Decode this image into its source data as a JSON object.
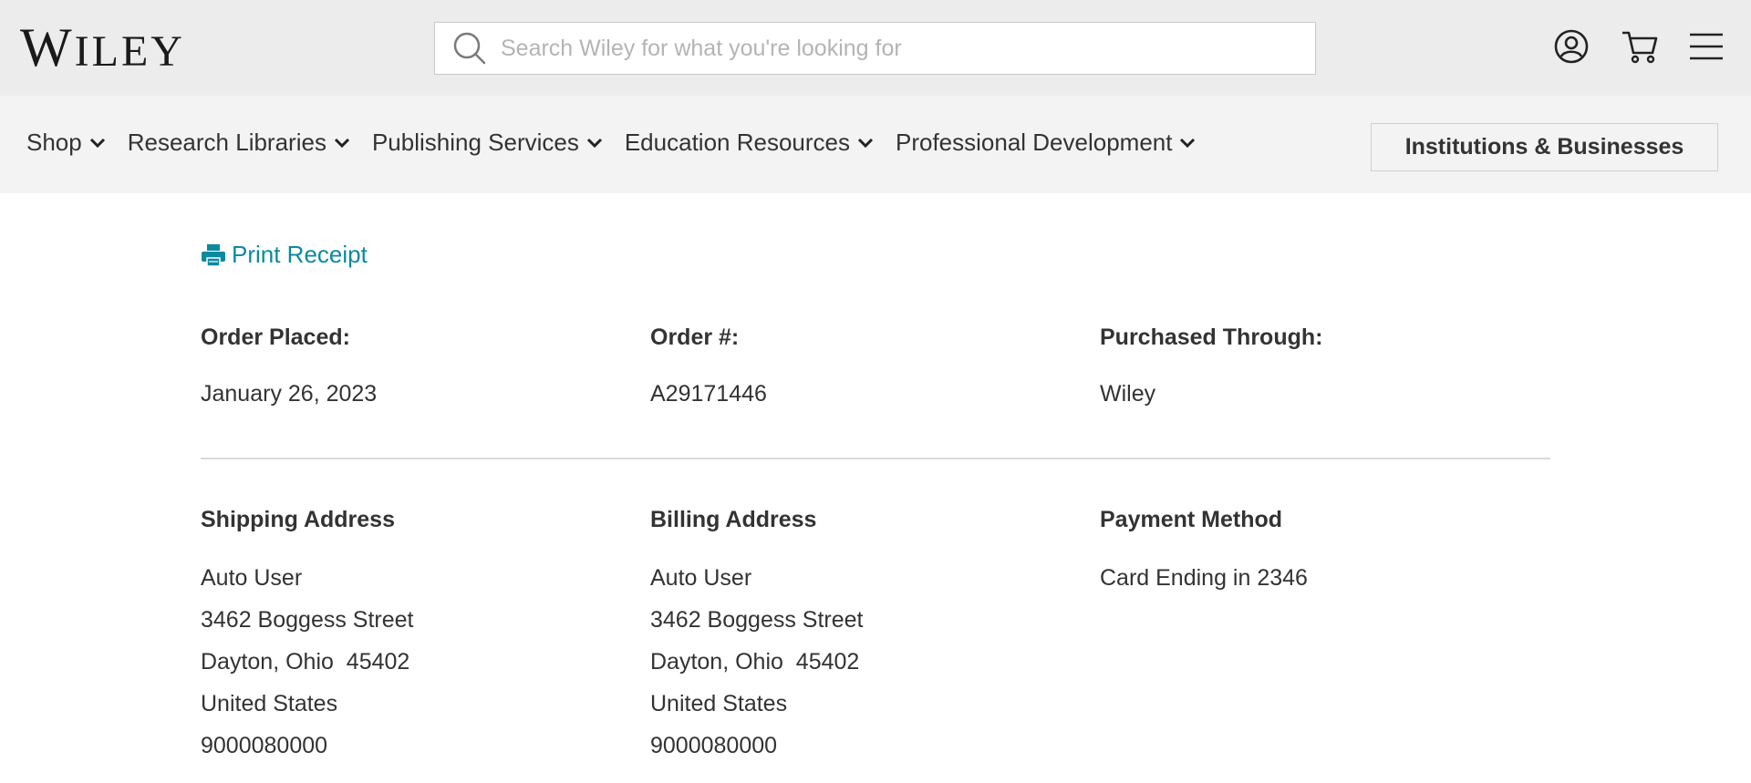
{
  "header": {
    "logo": {
      "cap": "W",
      "rest": "ILEY"
    },
    "search": {
      "placeholder": "Search Wiley for what you're looking for",
      "value": ""
    },
    "icons": [
      "account-icon",
      "cart-icon",
      "menu-icon"
    ]
  },
  "nav": {
    "items": [
      {
        "label": "Shop"
      },
      {
        "label": "Research Libraries"
      },
      {
        "label": "Publishing Services"
      },
      {
        "label": "Education Resources"
      },
      {
        "label": "Professional Development"
      }
    ],
    "institutions_button": "Institutions & Businesses"
  },
  "receipt": {
    "print_label": "Print Receipt",
    "order_placed": {
      "label": "Order Placed:",
      "value": "January 26, 2023"
    },
    "order_number": {
      "label": "Order #:",
      "value": "A29171446"
    },
    "purchased_through": {
      "label": "Purchased Through:",
      "value": "Wiley"
    },
    "shipping": {
      "label": "Shipping Address",
      "lines": [
        "Auto User",
        "3462 Boggess Street",
        "Dayton, Ohio  45402",
        "United States",
        "9000080000"
      ]
    },
    "billing": {
      "label": "Billing Address",
      "lines": [
        "Auto User",
        "3462 Boggess Street",
        "Dayton, Ohio  45402",
        "United States",
        "9000080000"
      ]
    },
    "payment": {
      "label": "Payment Method",
      "lines": [
        "Card Ending in 2346"
      ]
    }
  },
  "colors": {
    "accent": "#0a8a9f",
    "header_bg": "#ececec",
    "nav_bg": "#f3f3f3",
    "text": "#333333"
  }
}
